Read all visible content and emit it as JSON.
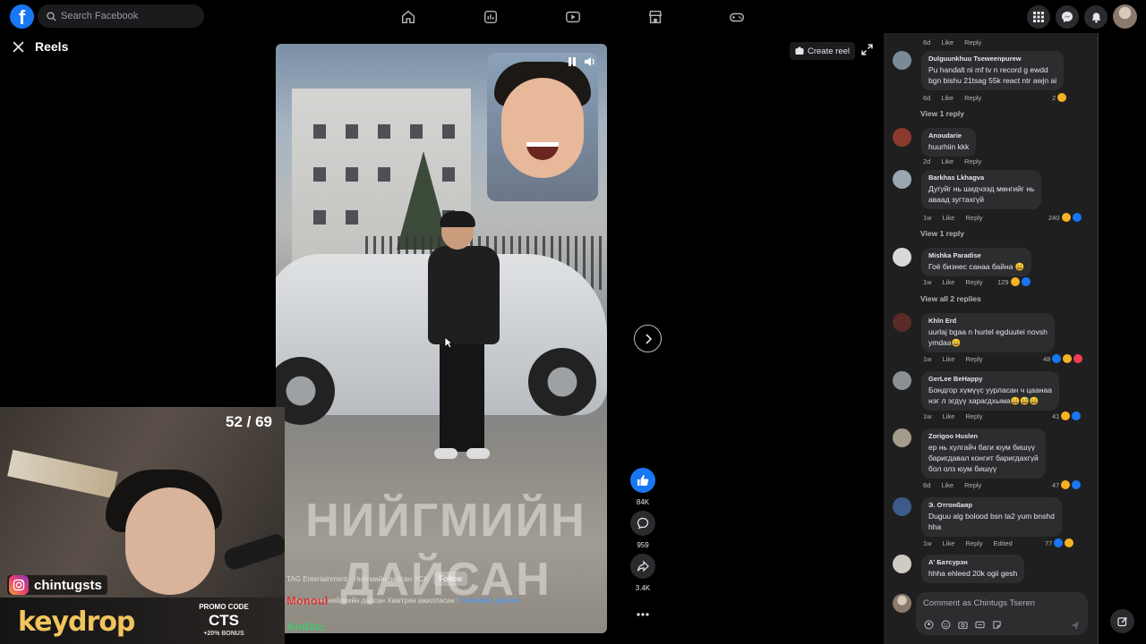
{
  "topbar": {
    "logo": "f",
    "search_placeholder": "Search Facebook",
    "nav_icons": [
      "home-icon",
      "news-icon",
      "video-icon",
      "marketplace-icon",
      "gaming-icon"
    ],
    "right_icons": [
      "menu-grid-icon",
      "messenger-icon",
      "bell-icon"
    ],
    "accent": "#1877f2"
  },
  "reels": {
    "title": "Reels",
    "create_reel_label": "Create reel"
  },
  "video": {
    "overlay_text": "НИЙГМИЙН ДАЙСАН",
    "caption": {
      "channel": "TAG Entertainment",
      "title": "Нийгмийн дайсан УСК",
      "follow_label": "Follow",
      "line2": "Катуу пранк  нийгмийн дайсан",
      "line2b": "Хамтран ажилласан :",
      "link": "Нийгмийн дайсан"
    }
  },
  "stream_overlay": {
    "counter": "52 / 69",
    "monoul": "Monoul",
    "andka": "Andka:",
    "instagram": "chintugsts",
    "keydrop": "keydrop",
    "promo_label": "PROMO CODE",
    "promo_code": "CTS",
    "bonus": "+20% BONUS"
  },
  "actions": {
    "likes": "84K",
    "comments": "959",
    "shares": "3.4K",
    "more": "..."
  },
  "comments": {
    "meta_labels": {
      "like": "Like",
      "reply": "Reply"
    },
    "top_meta_time": "6d",
    "items": [
      {
        "name": "Dulguunkhuu Tseweenpurew",
        "text": "Pu handalt ni mf tv n record g ewdd\nbgn bishu 21tsag 55k react ntr awjn ai",
        "time": "6d",
        "reactions": "2",
        "view_replies": "View 1 reply"
      },
      {
        "name": "Anoudarie",
        "text": "huurhiin kkk",
        "time": "2d",
        "reactions": "",
        "view_replies": ""
      },
      {
        "name": "Barkhas Lkhagva",
        "text": "Дугуйг нь шидчээд мөнгийг нь\nаваад зугтахгүй",
        "time": "1w",
        "reactions": "240",
        "view_replies": "View 1 reply"
      },
      {
        "name": "Mishka Paradise",
        "text": "Гоё бизнес санаа байна 😄",
        "time": "1w",
        "reactions": "129",
        "view_replies": "View all 2 replies"
      },
      {
        "name": "Khln Erd",
        "text": "uurlaj bgaa n hurtel egduutei novsh\nymdaa😄",
        "time": "1w",
        "reactions": "48",
        "view_replies": ""
      },
      {
        "name": "GerLee BeHappy",
        "text": "Бондгор хүмүүс уурласан ч цаанаа\nнэг л эгдүү харагдхыма😄😅😄",
        "time": "1w",
        "reactions": "41",
        "view_replies": ""
      },
      {
        "name": "Zorigoo Huslen",
        "text": "ер нь хулгайч баги юум бишүү\nбаригдавал конгит баригдахгүй\nбол олз юум бишүү",
        "time": "6d",
        "reactions": "47",
        "view_replies": ""
      },
      {
        "name": "Э. Отгонбаяр",
        "text": "Duguu alg bolood bsn ta2 yum bnshd\nhha",
        "time": "1w",
        "reactions": "77",
        "edited": "Edited",
        "view_replies": ""
      },
      {
        "name": "А' Батсурэн",
        "text": "hhha ehleed 20k ogii gesh",
        "time": "",
        "reactions": "",
        "view_replies": ""
      }
    ],
    "input_placeholder": "Comment as Chintugs Tseren"
  }
}
